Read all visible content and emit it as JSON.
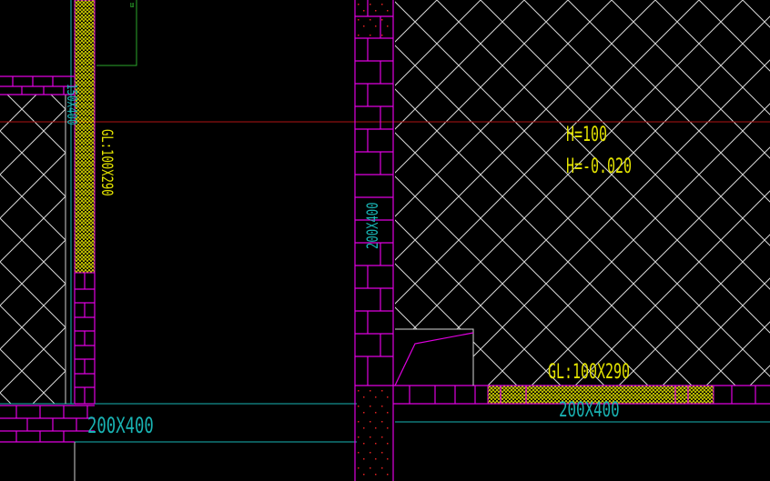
{
  "labels": {
    "lintel_vertical": "GL:100X290",
    "lintel_horizontal": "GL:100X290",
    "beam_left_vertical": "150X400",
    "beam_center_vertical": "200X400",
    "beam_left_bottom": "200X400",
    "beam_right_bottom": "200X400",
    "elevation_height": "H=100",
    "elevation_level": "H=-0.020"
  },
  "colors": {
    "background": "#000000",
    "brick": "#e000e0",
    "hatch": "#d8d8d8",
    "lintel_text": "#e4e400",
    "beam_text": "#19b3b3",
    "axis_red": "#b01515",
    "cyan_line": "#19b3b3",
    "green_line": "#2ca82c"
  }
}
